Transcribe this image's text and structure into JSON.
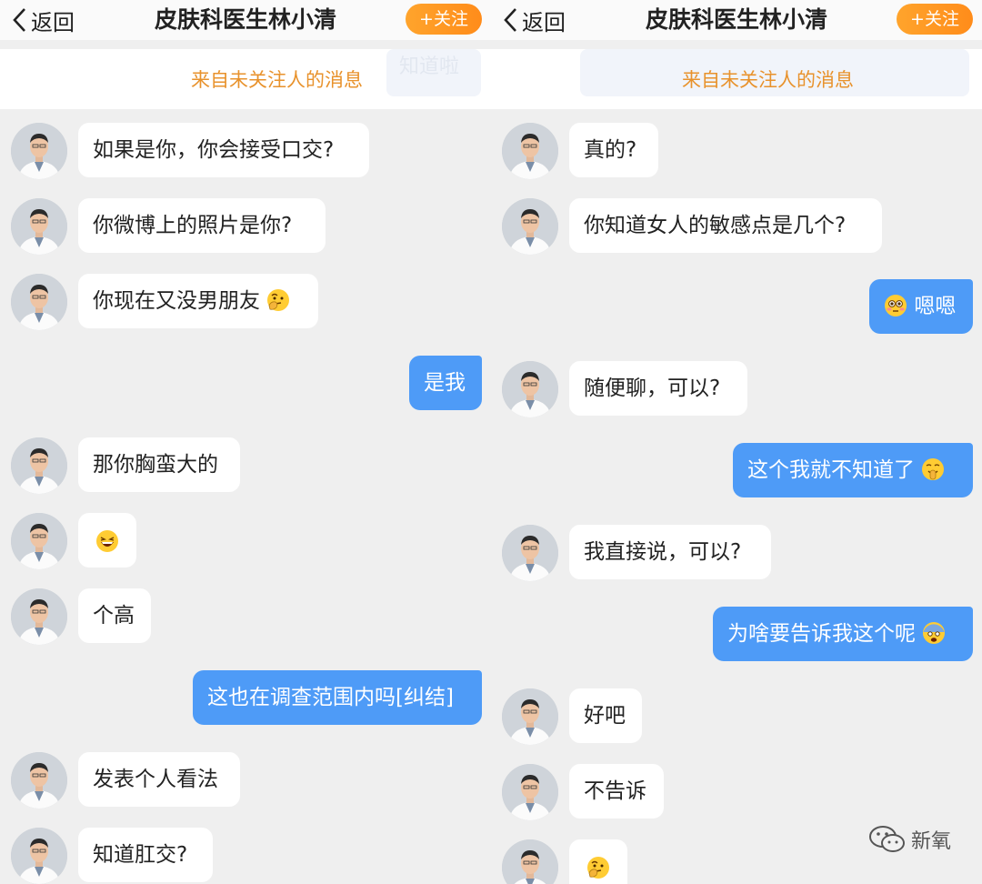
{
  "panels": [
    {
      "back_label": "返回",
      "title": "皮肤科医生林小清",
      "follow_label": "+关注",
      "notice": "来自未关注人的消息",
      "notice_ghost": "知道啦",
      "messages": [
        {
          "side": "in",
          "text": "如果是你，你会接受口交?"
        },
        {
          "side": "in",
          "text": "你微博上的照片是你?"
        },
        {
          "side": "in",
          "text": "你现在又没男朋友",
          "emoji": "thinking-emoji"
        },
        {
          "side": "out",
          "text": "是我"
        },
        {
          "side": "in",
          "text": "那你胸蛮大的"
        },
        {
          "side": "in",
          "text": "",
          "emoji": "laughing-emoji"
        },
        {
          "side": "in",
          "text": "个高"
        },
        {
          "side": "out",
          "text": "这也在调查范围内吗[纠结]"
        },
        {
          "side": "in",
          "text": "发表个人看法"
        },
        {
          "side": "in",
          "text": "知道肛交?"
        }
      ]
    },
    {
      "back_label": "返回",
      "title": "皮肤科医生林小清",
      "follow_label": "+关注",
      "notice": "来自未关注人的消息",
      "notice_ghost": "",
      "messages": [
        {
          "side": "in",
          "text": "真的?"
        },
        {
          "side": "in",
          "text": "你知道女人的敏感点是几个?"
        },
        {
          "side": "out",
          "text": "嗯嗯",
          "emoji_before": "flushed-emoji"
        },
        {
          "side": "in",
          "text": "随便聊，可以?"
        },
        {
          "side": "out",
          "text": "这个我就不知道了",
          "emoji": "shushing-emoji"
        },
        {
          "side": "in",
          "text": "我直接说，可以?"
        },
        {
          "side": "out",
          "text": "为啥要告诉我这个呢",
          "emoji": "fearful-emoji"
        },
        {
          "side": "in",
          "text": "好吧"
        },
        {
          "side": "in",
          "text": "不告诉"
        },
        {
          "side": "in",
          "text": "",
          "emoji": "thinking-emoji"
        }
      ]
    }
  ],
  "watermark": "新氧",
  "colors": {
    "accent_orange": "#ff9a22",
    "notice_text": "#e8922c",
    "outgoing_bubble": "#4e9bf7",
    "incoming_bubble": "#ffffff",
    "background": "#efefef"
  }
}
